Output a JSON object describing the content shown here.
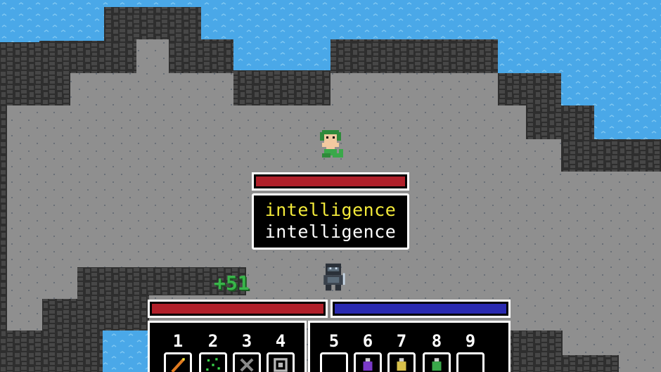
{
  "dialog": {
    "line1": "intelligence",
    "line2": "intelligence",
    "line1_color": "#f3ea3a",
    "line2_color": "#ffffff"
  },
  "floating_text": {
    "value": "+51",
    "color": "#39b54a"
  },
  "enemy": {
    "name": "medusa-icon",
    "hp_fraction": 1.0,
    "hp_color": "#b0202a"
  },
  "player": {
    "name": "armored-knight-icon",
    "hp_fraction": 1.0,
    "mp_fraction": 1.0,
    "hp_color": "#b0202a",
    "mp_color": "#2a2ab0"
  },
  "hotbar": {
    "slots": [
      {
        "number": "1",
        "icon": "wand-icon"
      },
      {
        "number": "2",
        "icon": "sparkles-icon"
      },
      {
        "number": "3",
        "icon": "crossed-swords-icon"
      },
      {
        "number": "4",
        "icon": "shield-ring-icon"
      },
      {
        "number": "5",
        "icon": "empty-slot"
      },
      {
        "number": "6",
        "icon": "purple-potion-icon"
      },
      {
        "number": "7",
        "icon": "yellow-potion-icon"
      },
      {
        "number": "8",
        "icon": "green-potion-icon"
      },
      {
        "number": "9",
        "icon": "empty-slot"
      }
    ]
  },
  "colors": {
    "water": "#4aa8e8",
    "rock": "#3a3a3a",
    "floor": "#8f8f8f"
  }
}
